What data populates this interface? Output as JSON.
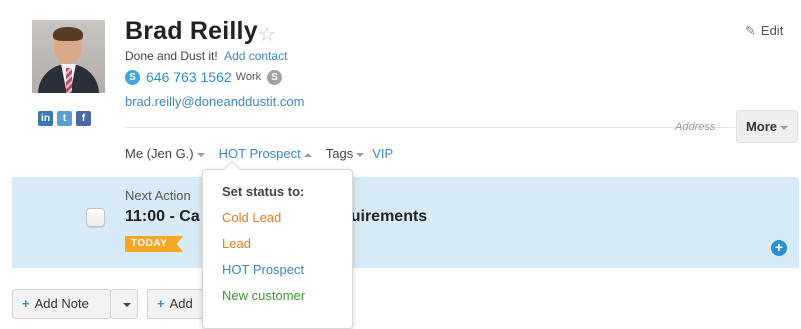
{
  "contact": {
    "name": "Brad Reilly",
    "company": "Done and Dust it!",
    "add_contact_label": "Add contact",
    "phone": "646 763 1562",
    "phone_type": "Work",
    "email": "brad.reilly@doneanddustit.com",
    "social": [
      "in",
      "t",
      "f"
    ]
  },
  "toolbar": {
    "edit_label": "Edit",
    "address_label": "Address",
    "more_label": "More"
  },
  "meta": {
    "owner": "Me (Jen G.)",
    "status": "HOT Prospect",
    "tags_label": "Tags",
    "tag_values": [
      "VIP"
    ]
  },
  "next_action": {
    "label": "Next Action",
    "title_left": "11:00 - Ca",
    "title_right": "uirements",
    "badge": "TODAY"
  },
  "status_menu": {
    "title": "Set status to:",
    "options": [
      {
        "label": "Cold Lead",
        "color": "#e8791f"
      },
      {
        "label": "Lead",
        "color": "#e8791f"
      },
      {
        "label": "HOT Prospect",
        "color": "#3a87c9"
      },
      {
        "label": "New customer",
        "color": "#3a9a2f"
      }
    ]
  },
  "buttons": {
    "add_note": "Add Note",
    "add_other": "Add"
  },
  "colors": {
    "link": "#3a87c9",
    "panel_bg": "#d6ebf7",
    "badge_bg": "#f5a623"
  }
}
